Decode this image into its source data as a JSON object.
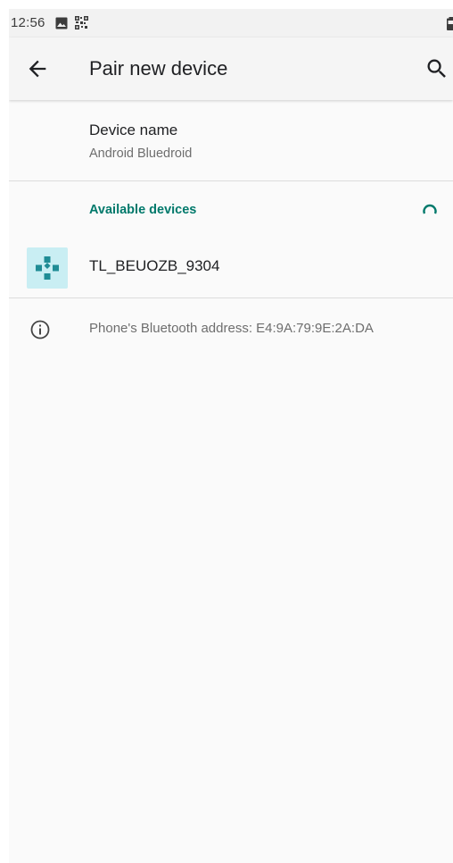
{
  "status_bar": {
    "time": "12:56",
    "icons": [
      "image-icon",
      "qr-code-icon",
      "battery-icon"
    ]
  },
  "app_bar": {
    "title": "Pair new device",
    "back_icon": "arrow-back-icon",
    "search_icon": "search-icon"
  },
  "device_name_pref": {
    "title": "Device name",
    "summary": "Android Bluedroid"
  },
  "available_devices": {
    "category_title": "Available devices",
    "progress_icon": "scanning-spinner-icon",
    "devices": [
      {
        "name": "TL_BEUOZB_9304",
        "icon": "gamepad-icon"
      }
    ]
  },
  "footer": {
    "icon": "info-icon",
    "text": "Phone's Bluetooth address: E4:9A:79:9E:2A:DA"
  },
  "colors": {
    "accent": "#00796b",
    "device_icon_bg": "#c9eef3",
    "device_icon_fg": "#1f8c95",
    "background": "#fafafa"
  }
}
